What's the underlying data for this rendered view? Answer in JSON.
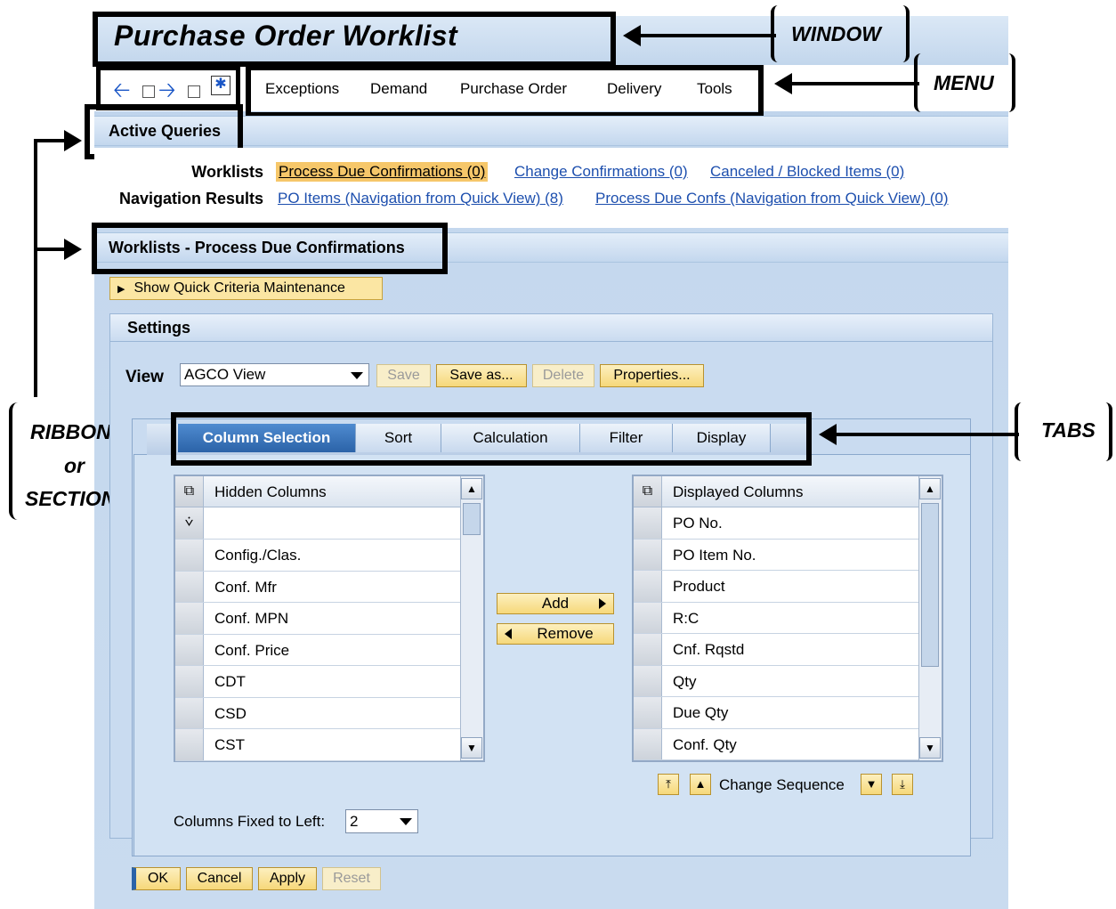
{
  "window": {
    "title": "Purchase Order Worklist"
  },
  "annotations": {
    "window": "WINDOW",
    "menu": "MENU",
    "tabs": "TABS",
    "ribbons_line1": "RIBBONS",
    "ribbons_line2": "or",
    "ribbons_line3": "SECTIONS"
  },
  "menu": {
    "items": [
      "Exceptions",
      "Demand",
      "Purchase Order",
      "Delivery",
      "Tools"
    ]
  },
  "active_queries": {
    "title": "Active Queries",
    "worklists_label": "Worklists",
    "worklists": [
      "Process Due Confirmations (0)",
      "Change Confirmations (0)",
      "Canceled / Blocked Items (0)"
    ],
    "nav_label": "Navigation Results",
    "nav_results": [
      "PO Items (Navigation from Quick View) (8)",
      "Process Due Confs (Navigation from Quick View) (0)"
    ]
  },
  "worklist_section": {
    "title": "Worklists - Process Due Confirmations",
    "quick_criteria": "Show Quick Criteria Maintenance"
  },
  "settings": {
    "title": "Settings",
    "view_label": "View",
    "view_value": "AGCO View",
    "buttons": {
      "save": "Save",
      "save_as": "Save as...",
      "delete": "Delete",
      "properties": "Properties..."
    }
  },
  "tabs": [
    "Column Selection",
    "Sort",
    "Calculation",
    "Filter",
    "Display"
  ],
  "hidden_columns": {
    "header": "Hidden Columns",
    "filter_value": "",
    "rows": [
      "Config./Clas.",
      "Conf. Mfr",
      "Conf. MPN",
      "Conf. Price",
      "CDT",
      "CSD",
      "CST"
    ]
  },
  "displayed_columns": {
    "header": "Displayed Columns",
    "rows": [
      "PO No.",
      "PO Item No.",
      "Product",
      "R:C",
      "Cnf. Rqstd",
      "Qty",
      "Due Qty",
      "Conf. Qty"
    ]
  },
  "transfer": {
    "add": "Add",
    "remove": "Remove"
  },
  "change_sequence": "Change Sequence",
  "fixed": {
    "label": "Columns Fixed to Left:",
    "value": "2"
  },
  "footer": {
    "ok": "OK",
    "cancel": "Cancel",
    "apply": "Apply",
    "reset": "Reset"
  },
  "colors": {
    "accent_tab": "#2b63a8",
    "link": "#1d4fae",
    "highlight": "#f6c76a",
    "button": "#f6d87a"
  }
}
